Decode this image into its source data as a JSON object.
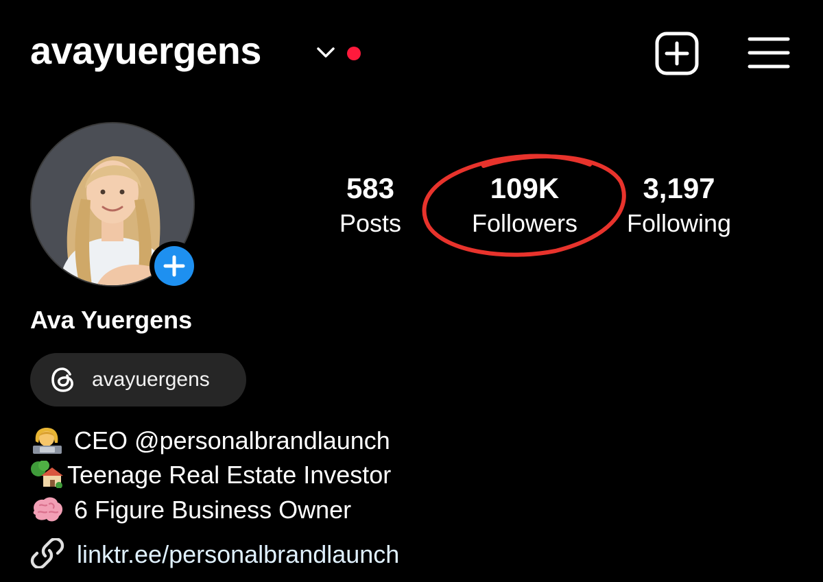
{
  "header": {
    "username": "avayuergens",
    "icons": [
      "chevron-down-icon",
      "notification-dot",
      "new-post-icon",
      "hamburger-menu-icon"
    ],
    "notification_color": "#ff1a3c"
  },
  "profile": {
    "display_name": "Ava Yuergens",
    "add_story_icon": "plus-icon",
    "add_story_color": "#1e90f0"
  },
  "stats": [
    {
      "value": "583",
      "label": "Posts"
    },
    {
      "value": "109K",
      "label": "Followers"
    },
    {
      "value": "3,197",
      "label": "Following"
    }
  ],
  "annotation": {
    "shape": "hand-drawn-circle",
    "target": "Followers",
    "color": "#e8332c"
  },
  "threads": {
    "icon": "threads-icon",
    "handle": "avayuergens"
  },
  "bio": [
    {
      "emoji": "woman-technologist-emoji",
      "text": "CEO @personalbrandlaunch"
    },
    {
      "emoji": "house-with-garden-emoji",
      "text": "Teenage Real Estate Investor"
    },
    {
      "emoji": "brain-emoji",
      "text": "6 Figure Business Owner"
    }
  ],
  "link": {
    "icon": "link-icon",
    "text": "linktr.ee/personalbrandlaunch"
  }
}
